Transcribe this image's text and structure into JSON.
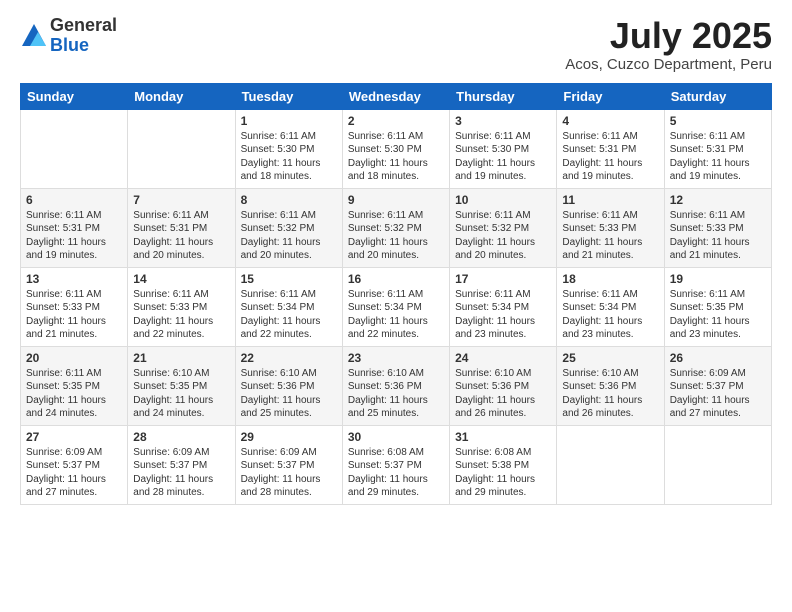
{
  "logo": {
    "general": "General",
    "blue": "Blue"
  },
  "header": {
    "month": "July 2025",
    "location": "Acos, Cuzco Department, Peru"
  },
  "days": [
    "Sunday",
    "Monday",
    "Tuesday",
    "Wednesday",
    "Thursday",
    "Friday",
    "Saturday"
  ],
  "weeks": [
    [
      {
        "day": "",
        "content": ""
      },
      {
        "day": "",
        "content": ""
      },
      {
        "day": "1",
        "content": "Sunrise: 6:11 AM\nSunset: 5:30 PM\nDaylight: 11 hours and 18 minutes."
      },
      {
        "day": "2",
        "content": "Sunrise: 6:11 AM\nSunset: 5:30 PM\nDaylight: 11 hours and 18 minutes."
      },
      {
        "day": "3",
        "content": "Sunrise: 6:11 AM\nSunset: 5:30 PM\nDaylight: 11 hours and 19 minutes."
      },
      {
        "day": "4",
        "content": "Sunrise: 6:11 AM\nSunset: 5:31 PM\nDaylight: 11 hours and 19 minutes."
      },
      {
        "day": "5",
        "content": "Sunrise: 6:11 AM\nSunset: 5:31 PM\nDaylight: 11 hours and 19 minutes."
      }
    ],
    [
      {
        "day": "6",
        "content": "Sunrise: 6:11 AM\nSunset: 5:31 PM\nDaylight: 11 hours and 19 minutes."
      },
      {
        "day": "7",
        "content": "Sunrise: 6:11 AM\nSunset: 5:31 PM\nDaylight: 11 hours and 20 minutes."
      },
      {
        "day": "8",
        "content": "Sunrise: 6:11 AM\nSunset: 5:32 PM\nDaylight: 11 hours and 20 minutes."
      },
      {
        "day": "9",
        "content": "Sunrise: 6:11 AM\nSunset: 5:32 PM\nDaylight: 11 hours and 20 minutes."
      },
      {
        "day": "10",
        "content": "Sunrise: 6:11 AM\nSunset: 5:32 PM\nDaylight: 11 hours and 20 minutes."
      },
      {
        "day": "11",
        "content": "Sunrise: 6:11 AM\nSunset: 5:33 PM\nDaylight: 11 hours and 21 minutes."
      },
      {
        "day": "12",
        "content": "Sunrise: 6:11 AM\nSunset: 5:33 PM\nDaylight: 11 hours and 21 minutes."
      }
    ],
    [
      {
        "day": "13",
        "content": "Sunrise: 6:11 AM\nSunset: 5:33 PM\nDaylight: 11 hours and 21 minutes."
      },
      {
        "day": "14",
        "content": "Sunrise: 6:11 AM\nSunset: 5:33 PM\nDaylight: 11 hours and 22 minutes."
      },
      {
        "day": "15",
        "content": "Sunrise: 6:11 AM\nSunset: 5:34 PM\nDaylight: 11 hours and 22 minutes."
      },
      {
        "day": "16",
        "content": "Sunrise: 6:11 AM\nSunset: 5:34 PM\nDaylight: 11 hours and 22 minutes."
      },
      {
        "day": "17",
        "content": "Sunrise: 6:11 AM\nSunset: 5:34 PM\nDaylight: 11 hours and 23 minutes."
      },
      {
        "day": "18",
        "content": "Sunrise: 6:11 AM\nSunset: 5:34 PM\nDaylight: 11 hours and 23 minutes."
      },
      {
        "day": "19",
        "content": "Sunrise: 6:11 AM\nSunset: 5:35 PM\nDaylight: 11 hours and 23 minutes."
      }
    ],
    [
      {
        "day": "20",
        "content": "Sunrise: 6:11 AM\nSunset: 5:35 PM\nDaylight: 11 hours and 24 minutes."
      },
      {
        "day": "21",
        "content": "Sunrise: 6:10 AM\nSunset: 5:35 PM\nDaylight: 11 hours and 24 minutes."
      },
      {
        "day": "22",
        "content": "Sunrise: 6:10 AM\nSunset: 5:36 PM\nDaylight: 11 hours and 25 minutes."
      },
      {
        "day": "23",
        "content": "Sunrise: 6:10 AM\nSunset: 5:36 PM\nDaylight: 11 hours and 25 minutes."
      },
      {
        "day": "24",
        "content": "Sunrise: 6:10 AM\nSunset: 5:36 PM\nDaylight: 11 hours and 26 minutes."
      },
      {
        "day": "25",
        "content": "Sunrise: 6:10 AM\nSunset: 5:36 PM\nDaylight: 11 hours and 26 minutes."
      },
      {
        "day": "26",
        "content": "Sunrise: 6:09 AM\nSunset: 5:37 PM\nDaylight: 11 hours and 27 minutes."
      }
    ],
    [
      {
        "day": "27",
        "content": "Sunrise: 6:09 AM\nSunset: 5:37 PM\nDaylight: 11 hours and 27 minutes."
      },
      {
        "day": "28",
        "content": "Sunrise: 6:09 AM\nSunset: 5:37 PM\nDaylight: 11 hours and 28 minutes."
      },
      {
        "day": "29",
        "content": "Sunrise: 6:09 AM\nSunset: 5:37 PM\nDaylight: 11 hours and 28 minutes."
      },
      {
        "day": "30",
        "content": "Sunrise: 6:08 AM\nSunset: 5:37 PM\nDaylight: 11 hours and 29 minutes."
      },
      {
        "day": "31",
        "content": "Sunrise: 6:08 AM\nSunset: 5:38 PM\nDaylight: 11 hours and 29 minutes."
      },
      {
        "day": "",
        "content": ""
      },
      {
        "day": "",
        "content": ""
      }
    ]
  ]
}
